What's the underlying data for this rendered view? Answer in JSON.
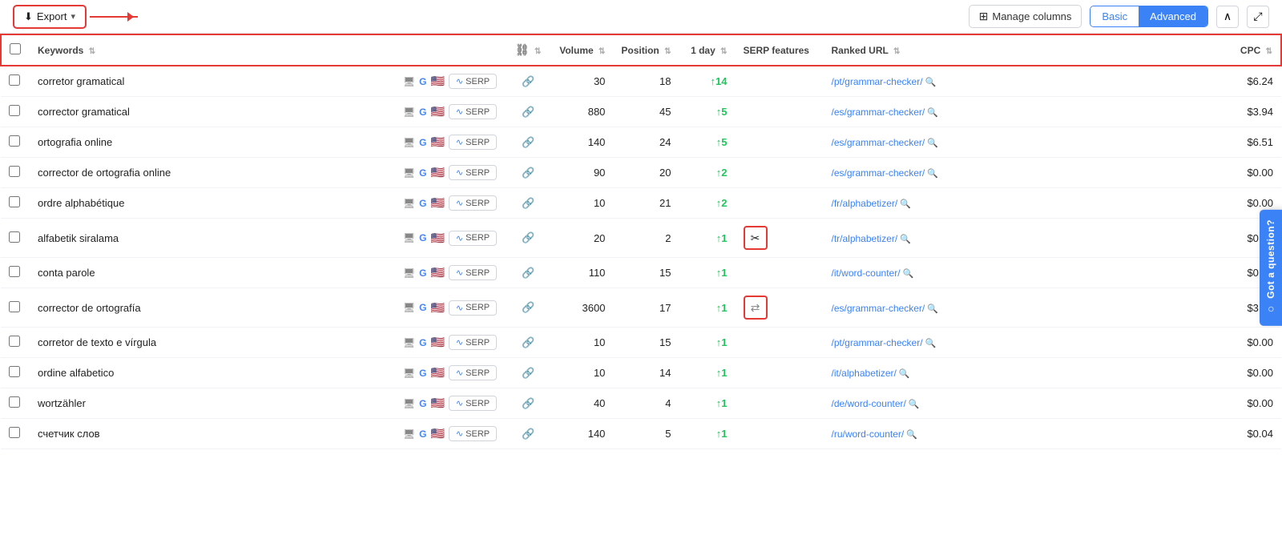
{
  "toolbar": {
    "export_label": "Export",
    "manage_columns_label": "Manage columns",
    "view_basic": "Basic",
    "view_advanced": "Advanced",
    "collapse_icon": "∧",
    "expand_icon": "⤢"
  },
  "table": {
    "columns": [
      {
        "id": "checkbox",
        "label": ""
      },
      {
        "id": "keyword",
        "label": "Keywords"
      },
      {
        "id": "icons",
        "label": ""
      },
      {
        "id": "link",
        "label": ""
      },
      {
        "id": "volume",
        "label": "Volume"
      },
      {
        "id": "position",
        "label": "Position"
      },
      {
        "id": "1day",
        "label": "1 day"
      },
      {
        "id": "serp",
        "label": "SERP features"
      },
      {
        "id": "url",
        "label": "Ranked URL"
      },
      {
        "id": "cpc",
        "label": "CPC"
      }
    ],
    "rows": [
      {
        "keyword": "corretor gramatical",
        "volume": "30",
        "position": "18",
        "change": "+14",
        "change_type": "up",
        "serp_feature": "",
        "ranked_url": "/pt/grammar-checker/",
        "cpc": "$6.24"
      },
      {
        "keyword": "corrector gramatical",
        "volume": "880",
        "position": "45",
        "change": "+5",
        "change_type": "up",
        "serp_feature": "",
        "ranked_url": "/es/grammar-checker/",
        "cpc": "$3.94"
      },
      {
        "keyword": "ortografia online",
        "volume": "140",
        "position": "24",
        "change": "+5",
        "change_type": "up",
        "serp_feature": "",
        "ranked_url": "/es/grammar-checker/",
        "cpc": "$6.51"
      },
      {
        "keyword": "corrector de ortografia online",
        "volume": "90",
        "position": "20",
        "change": "+2",
        "change_type": "up",
        "serp_feature": "",
        "ranked_url": "/es/grammar-checker/",
        "cpc": "$0.00"
      },
      {
        "keyword": "ordre alphabétique",
        "volume": "10",
        "position": "21",
        "change": "+2",
        "change_type": "up",
        "serp_feature": "",
        "ranked_url": "/fr/alphabetizer/",
        "cpc": "$0.00"
      },
      {
        "keyword": "alfabetik siralama",
        "volume": "20",
        "position": "2",
        "change": "+1",
        "change_type": "up",
        "serp_feature": "scissors",
        "ranked_url": "/tr/alphabetizer/",
        "cpc": "$0.00"
      },
      {
        "keyword": "conta parole",
        "volume": "110",
        "position": "15",
        "change": "+1",
        "change_type": "up",
        "serp_feature": "",
        "ranked_url": "/it/word-counter/",
        "cpc": "$0.00"
      },
      {
        "keyword": "corrector de ortografía",
        "volume": "3600",
        "position": "17",
        "change": "+1",
        "change_type": "up",
        "serp_feature": "arrows",
        "ranked_url": "/es/grammar-checker/",
        "cpc": "$3.04"
      },
      {
        "keyword": "corretor de texto e vírgula",
        "volume": "10",
        "position": "15",
        "change": "+1",
        "change_type": "up",
        "serp_feature": "",
        "ranked_url": "/pt/grammar-checker/",
        "cpc": "$0.00"
      },
      {
        "keyword": "ordine alfabetico",
        "volume": "10",
        "position": "14",
        "change": "+1",
        "change_type": "up",
        "serp_feature": "",
        "ranked_url": "/it/alphabetizer/",
        "cpc": "$0.00"
      },
      {
        "keyword": "wortzähler",
        "volume": "40",
        "position": "4",
        "change": "+1",
        "change_type": "up",
        "serp_feature": "",
        "ranked_url": "/de/word-counter/",
        "cpc": "$0.00"
      },
      {
        "keyword": "счетчик слов",
        "volume": "140",
        "position": "5",
        "change": "+1",
        "change_type": "up",
        "serp_feature": "",
        "ranked_url": "/ru/word-counter/",
        "cpc": "$0.04"
      }
    ]
  },
  "got_question": "Got a question?"
}
